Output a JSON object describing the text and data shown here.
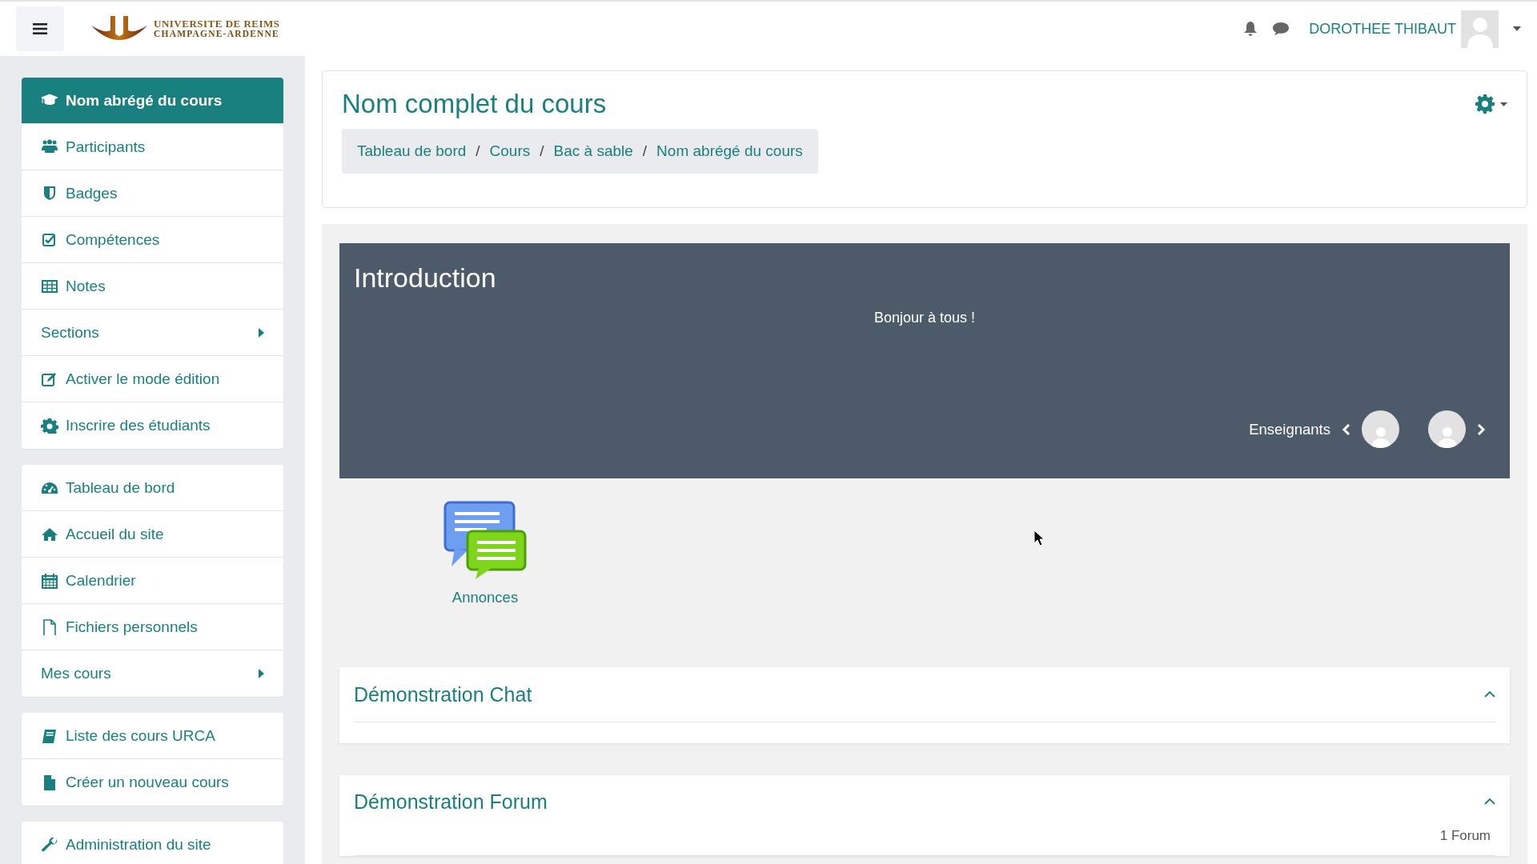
{
  "header": {
    "logo_line1": "UNIVERSITE DE REIMS",
    "logo_line2": "CHAMPAGNE-ARDENNE",
    "user_name": "DOROTHEE THIBAUT"
  },
  "sidebar": {
    "groups": [
      {
        "items": [
          {
            "label": "Nom abrégé du cours",
            "kind": "link",
            "selected": true
          },
          {
            "label": "Participants",
            "kind": "link",
            "selected": false
          },
          {
            "label": "Badges",
            "kind": "link",
            "selected": false
          },
          {
            "label": "Compétences",
            "kind": "link",
            "selected": false
          },
          {
            "label": "Notes",
            "kind": "link",
            "selected": false
          },
          {
            "label": "Sections",
            "kind": "submenu",
            "selected": false
          },
          {
            "label": "Activer le mode édition",
            "kind": "link",
            "selected": false
          },
          {
            "label": "Inscrire des étudiants",
            "kind": "link",
            "selected": false
          }
        ]
      },
      {
        "items": [
          {
            "label": "Tableau de bord",
            "kind": "link",
            "selected": false
          },
          {
            "label": "Accueil du site",
            "kind": "link",
            "selected": false
          },
          {
            "label": "Calendrier",
            "kind": "link",
            "selected": false
          },
          {
            "label": "Fichiers personnels",
            "kind": "link",
            "selected": false
          },
          {
            "label": "Mes cours",
            "kind": "submenu",
            "selected": false
          }
        ]
      },
      {
        "items": [
          {
            "label": "Liste des cours URCA",
            "kind": "link",
            "selected": false
          },
          {
            "label": "Créer un nouveau cours",
            "kind": "link",
            "selected": false
          }
        ]
      },
      {
        "items": [
          {
            "label": "Administration du site",
            "kind": "link",
            "selected": false
          }
        ]
      }
    ]
  },
  "page_header": {
    "title": "Nom complet du cours",
    "breadcrumb": [
      "Tableau de bord",
      "Cours",
      "Bac à sable",
      "Nom abrégé du cours"
    ],
    "separators": [
      "/",
      "/",
      "/"
    ]
  },
  "intro": {
    "title": "Introduction",
    "text": "Bonjour à tous !",
    "teachers_label": "Enseignants"
  },
  "activity": {
    "label": "Annonces"
  },
  "sections": [
    {
      "title": "Démonstration Chat",
      "expanded": true
    },
    {
      "title": "Démonstration Forum",
      "expanded": true,
      "summary": "1 Forum"
    }
  ]
}
